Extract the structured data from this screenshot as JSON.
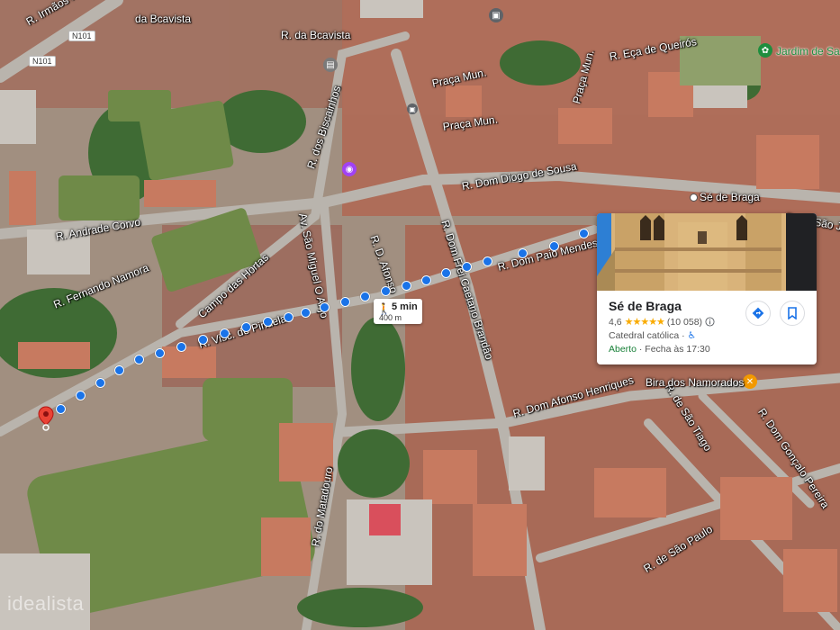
{
  "colors": {
    "route": "#1a73e8",
    "pin": "#ea4335",
    "rating_star": "#f9ab00",
    "open_status": "#188038",
    "park_label": "#1e8e3e"
  },
  "streets": {
    "irmaos": "R. Irmãos K",
    "bcavista_top": "da Bcavista",
    "bcavista": "R. da Bcavista",
    "biscainhos": "R. dos Biscainhos",
    "praca_mun_1": "Praça Mun.",
    "praca_mun_2": "Praça Mun.",
    "praca_mun_3": "Praça Mun.",
    "eca": "R. Eça de Queirós",
    "dom_diogo": "R. Dom Diogo de Sousa",
    "andrade_corvo": "R. Andrade Corvo",
    "sao_miguel": "Av. São Miguel O Anjo",
    "d_afonso_top": "R. D. Afonso",
    "dom_frei": "R. Dom Frei Caetano Brandão",
    "dom_paio": "R. Dom Paio Mendes",
    "campo_hortas": "Campo das Hortas",
    "fernando_namora": "R. Fernando Namora",
    "visc_pindela": "R. Visc. de Pindela",
    "dom_afonso_henriques": "R. Dom Afonso Henriques",
    "sao_tiago": "R. de São Tiago",
    "dom_goncalo": "R. Dom Gonçalo Pereira",
    "matadouro": "R. do Matadouro",
    "sao_paulo": "R. de São Paulo",
    "se_joao": "R. de São João",
    "se_braga_small": "Sé de Braga"
  },
  "road_shields": {
    "n101_a": "N101",
    "n101_b": "N101"
  },
  "pois": {
    "jardim": "Jardim de Sa",
    "bira": "Bira dos Namorados"
  },
  "walk": {
    "icon": "walking-person-icon",
    "time": "5 min",
    "distance": "400 m"
  },
  "place_card": {
    "name": "Sé de Braga",
    "rating": "4,6",
    "stars": "★★★★★",
    "review_count": "(10 058)",
    "type": "Catedral católica",
    "status": "Aberto",
    "hours": "Fecha às 17:30",
    "directions_icon": "directions-icon",
    "save_icon": "bookmark-icon",
    "info_icon": "info-icon",
    "accessible_icon": "wheelchair-icon"
  },
  "watermark": "idealista"
}
